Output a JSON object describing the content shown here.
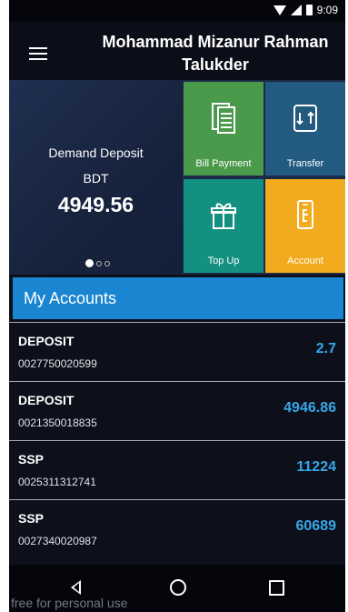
{
  "status_bar": {
    "time": "9:09",
    "icons": [
      "wifi-icon",
      "signal-icon",
      "battery-icon"
    ]
  },
  "header": {
    "title": "Mohammad Mizanur Rahman Talukder",
    "menu_icon": "hamburger-menu-icon"
  },
  "balance_card": {
    "account_type": "Demand Deposit",
    "currency": "BDT",
    "balance": "4949.56",
    "carousel_pages": 3,
    "carousel_active": 1
  },
  "tiles": [
    {
      "label": "Bill Payment",
      "icon": "bill-icon",
      "color": "#4b9a4b"
    },
    {
      "label": "Transfer",
      "icon": "transfer-icon",
      "color": "#225a80"
    },
    {
      "label": "Top Up",
      "icon": "gift-box-icon",
      "color": "#139080"
    },
    {
      "label": "Account",
      "icon": "mobile-taka-icon",
      "color": "#f2aa1e"
    }
  ],
  "accounts_section": {
    "title": "My Accounts",
    "accent": "#1a86d1"
  },
  "accounts": [
    {
      "name": "DEPOSIT",
      "number": "0027750020599",
      "amount": "2.7"
    },
    {
      "name": "DEPOSIT",
      "number": "0021350018835",
      "amount": "4946.86"
    },
    {
      "name": "SSP",
      "number": "0025311312741",
      "amount": "11224"
    },
    {
      "name": "SSP",
      "number": "0027340020987",
      "amount": "60689"
    }
  ],
  "nav_bar": {
    "icons": [
      "back-icon",
      "home-icon",
      "recent-apps-icon"
    ]
  },
  "watermark": "free for personal use"
}
